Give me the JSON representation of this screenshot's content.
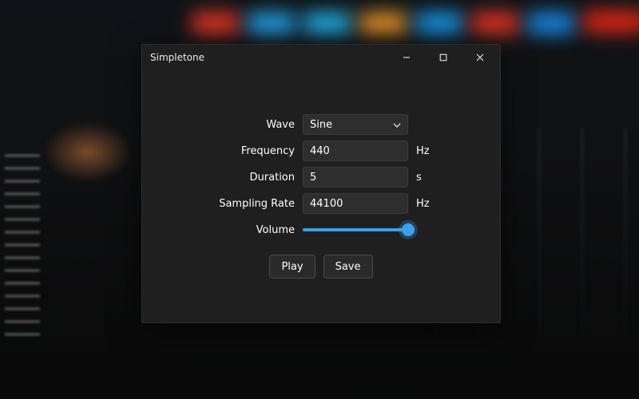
{
  "window": {
    "title": "Simpletone"
  },
  "labels": {
    "wave": "Wave",
    "frequency": "Frequency",
    "duration": "Duration",
    "sampling_rate": "Sampling Rate",
    "volume": "Volume"
  },
  "fields": {
    "wave": {
      "value": "Sine"
    },
    "frequency": {
      "value": "440",
      "unit": "Hz"
    },
    "duration": {
      "value": "5",
      "unit": "s"
    },
    "sampling_rate": {
      "value": "44100",
      "unit": "Hz"
    },
    "volume": {
      "percent": 100
    }
  },
  "buttons": {
    "play": "Play",
    "save": "Save"
  },
  "colors": {
    "accent": "#3aa0ef",
    "window_bg": "#1f1f1f",
    "input_bg": "#2e2e2e"
  }
}
